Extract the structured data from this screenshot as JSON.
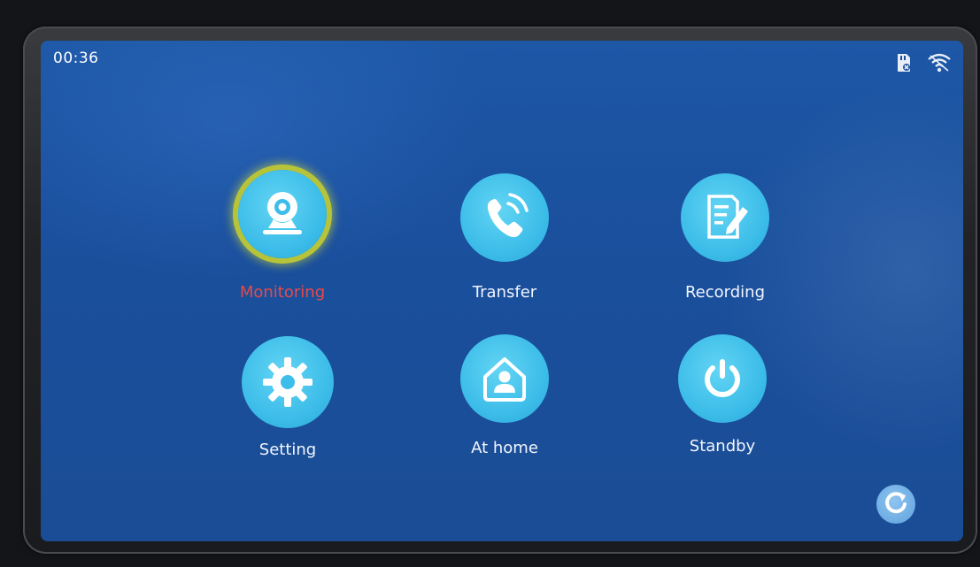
{
  "status_bar": {
    "time": "00:36",
    "icons": [
      "sd-card-icon",
      "wifi-icon"
    ]
  },
  "menu": {
    "selected": "monitoring",
    "items": [
      {
        "id": "monitoring",
        "label": "Monitoring",
        "icon": "camera-icon"
      },
      {
        "id": "transfer",
        "label": "Transfer",
        "icon": "phone-call-icon"
      },
      {
        "id": "recording",
        "label": "Recording",
        "icon": "notepad-pen-icon"
      },
      {
        "id": "setting",
        "label": "Setting",
        "icon": "gear-icon"
      },
      {
        "id": "at-home",
        "label": "At home",
        "icon": "home-person-icon"
      },
      {
        "id": "standby",
        "label": "Standby",
        "icon": "power-icon"
      }
    ]
  },
  "refresh": {
    "icon": "refresh-icon"
  },
  "colors": {
    "screen_bg": "#1a4f9c",
    "icon_circle": "#3dbde9",
    "selected_ring": "#b7c43a",
    "selected_label": "#e64a4a",
    "label": "#f2f6ff"
  }
}
